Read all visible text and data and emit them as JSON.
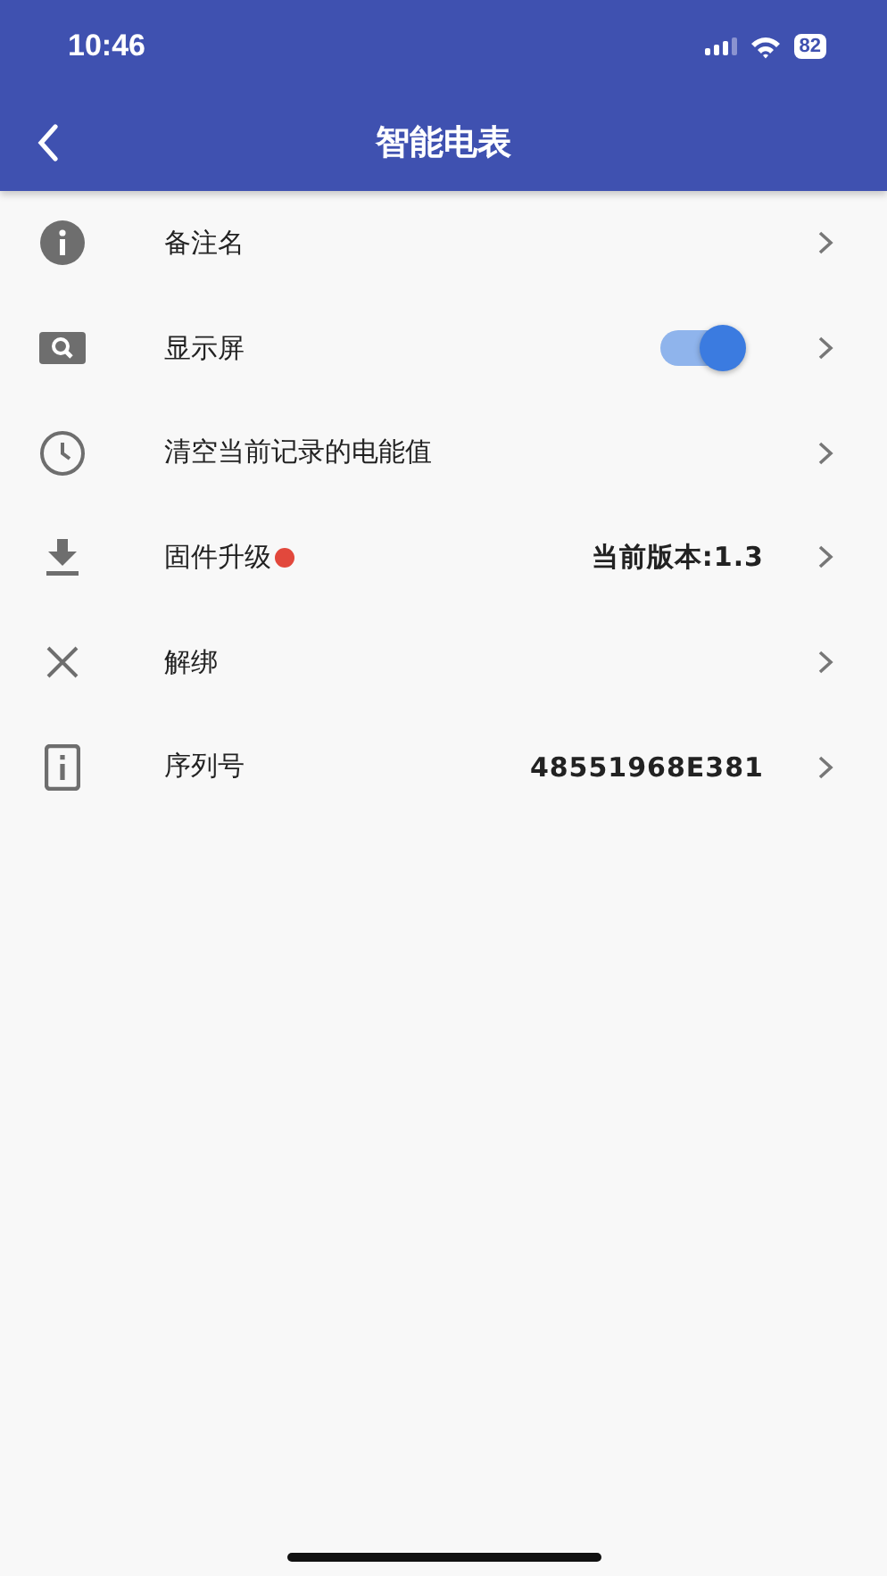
{
  "status_bar": {
    "time": "10:46",
    "battery": "82"
  },
  "header": {
    "title": "智能电表"
  },
  "rows": [
    {
      "label": "备注名",
      "badge": false
    },
    {
      "label": "显示屏",
      "badge": false,
      "toggle": {
        "on": true
      }
    },
    {
      "label": "清空当前记录的电能值",
      "badge": false
    },
    {
      "label": "固件升级",
      "badge": true,
      "value": "当前版本:1.3"
    },
    {
      "label": "解绑",
      "badge": false
    },
    {
      "label": "序列号",
      "badge": false,
      "value": "48551968E381"
    }
  ]
}
